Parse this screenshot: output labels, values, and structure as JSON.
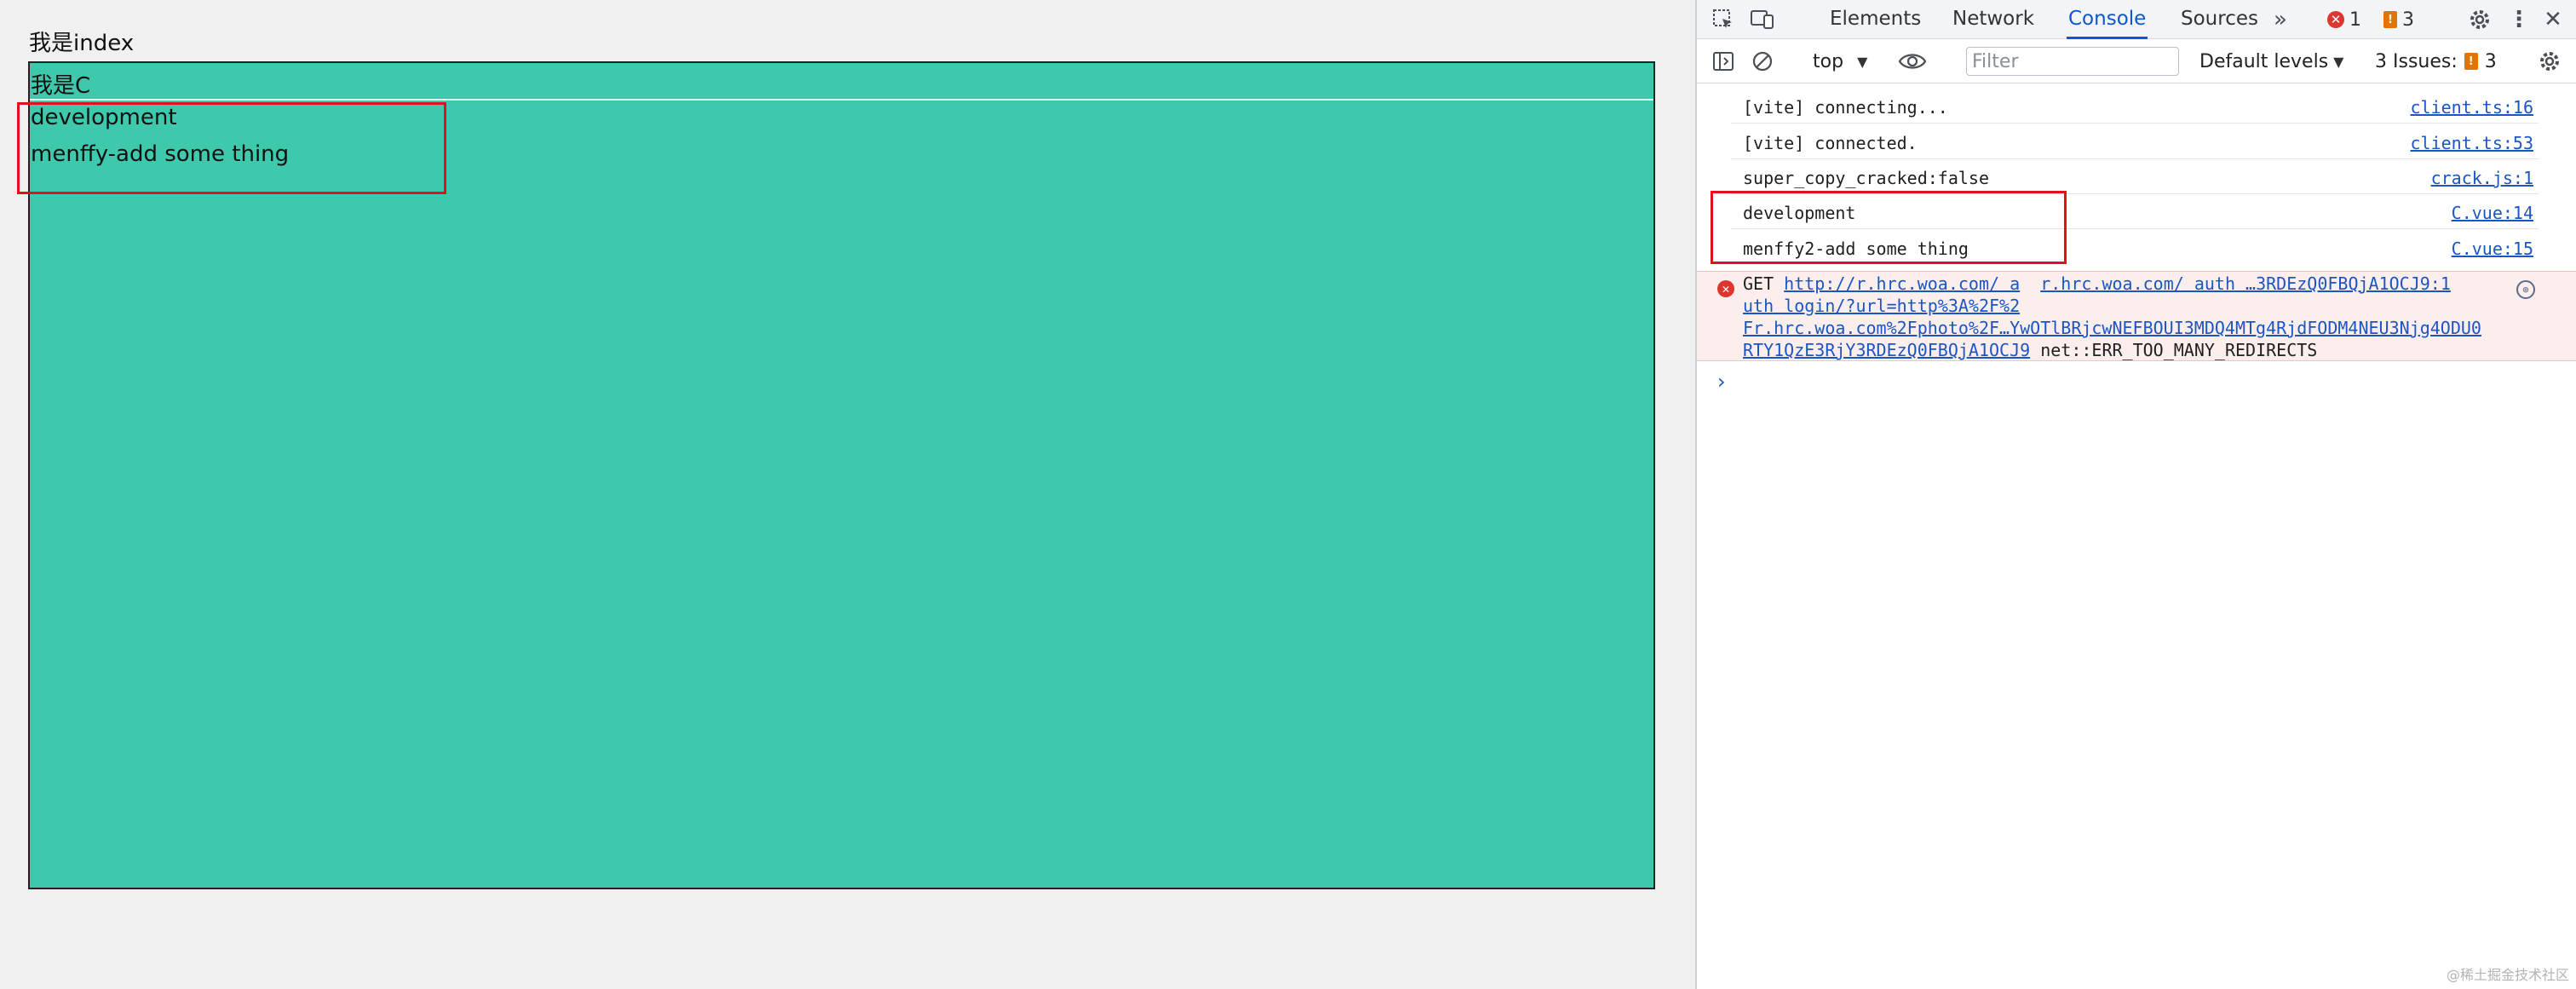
{
  "page": {
    "index_title": "我是index",
    "component": {
      "title": "我是C",
      "lines": [
        "development",
        "menffy-add some thing"
      ],
      "background": "#3ec9ad"
    },
    "highlight_color": "#e0111b"
  },
  "devtools": {
    "tabs": [
      {
        "label": "Elements",
        "active": false
      },
      {
        "label": "Network",
        "active": false
      },
      {
        "label": "Console",
        "active": true
      },
      {
        "label": "Sources",
        "active": false
      }
    ],
    "more_tabs_icon": "double-chevron-right-icon",
    "error_count": "1",
    "warning_count": "3",
    "toolbar": {
      "context": "top",
      "filter_placeholder": "Filter",
      "levels": "Default levels",
      "issues_label": "3 Issues:",
      "issues_count": "3"
    },
    "console": {
      "messages": [
        {
          "text": "[vite] connecting...",
          "source": "client.ts:16"
        },
        {
          "text": "[vite] connected.",
          "source": "client.ts:53"
        },
        {
          "text": "super_copy_cracked:false",
          "source": "crack.js:1"
        },
        {
          "text": "development",
          "source": "C.vue:14"
        },
        {
          "text": "menffy2-add some thing",
          "source": "C.vue:15"
        }
      ],
      "error": {
        "method": "GET",
        "url_line1": "http://r.hrc.woa.com/ a",
        "url_line1_link2": "r.hrc.woa.com/ auth …3RDEzQ0FBQjA1OCJ9:1",
        "url_line2": "uth login/?url=http%3A%2F%2",
        "url_line3": "Fr.hrc.woa.com%2Fphoto%2F…YwOTlBRjcwNEFBOUI3MDQ4MTg4RjdFODM4NEU3Njg4ODU0",
        "url_line4": "RTY1QzE3RjY3RDEzQ0FBQjA1OCJ9",
        "reason": "net::ERR_TOO_MANY_REDIRECTS"
      }
    },
    "accent_color": "#0b57d0"
  },
  "watermark": "@稀土掘金技术社区"
}
